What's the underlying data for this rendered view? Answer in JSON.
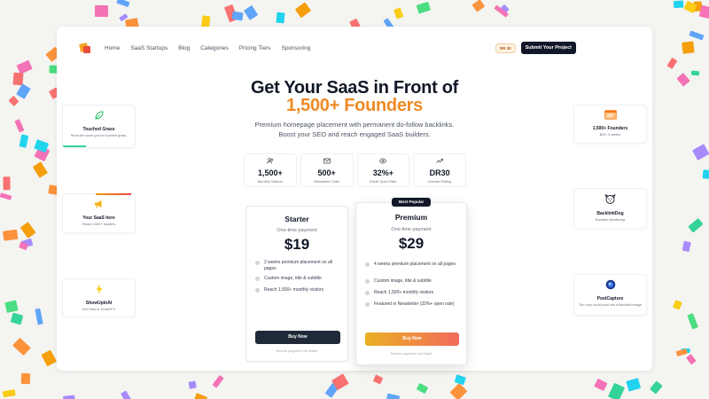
{
  "nav": {
    "links": [
      "Home",
      "SaaS Startups",
      "Blog",
      "Categories",
      "Pricing Tiers",
      "Sponsoring"
    ],
    "dr_badge": "DR 30",
    "submit_label": "Submit Your Project"
  },
  "hero": {
    "title_line1": "Get Your SaaS in Front of",
    "title_line2": "1,500+ Founders",
    "subtitle_line1": "Premium homepage placement with permanent do-follow backlinks.",
    "subtitle_line2": "Boost your SEO and reach engaged SaaS builders.",
    "accent_color": "#f08a24"
  },
  "stats": [
    {
      "icon": "users-icon",
      "value": "1,500+",
      "label": "Monthly Visitors"
    },
    {
      "icon": "mail-icon",
      "value": "500+",
      "label": "Newsletter Subs"
    },
    {
      "icon": "eye-icon",
      "value": "32%+",
      "label": "Email Open Rate"
    },
    {
      "icon": "trend-up-icon",
      "value": "DR30",
      "label": "Domain Rating"
    }
  ],
  "plans": {
    "starter": {
      "name": "Starter",
      "period": "One-time payment",
      "price": "$19",
      "features": [
        "2 weeks premium placement on all pages",
        "Custom image, title & subtitle",
        "Reach 1,500+ monthly visitors"
      ],
      "cta": "Buy Now",
      "note": "Secure payment via Stripe"
    },
    "premium": {
      "badge": "Most Popular",
      "name": "Premium",
      "period": "One-time payment",
      "price": "$29",
      "features": [
        "4 weeks premium placement on all pages",
        "Custom image, title & subtitle",
        "Reach 1,500+ monthly visitors",
        "Featured in Newsletter (32%+ open rate)"
      ],
      "cta": "Buy Now",
      "note": "Secure payment via Stripe"
    }
  },
  "left_promos": [
    {
      "icon": "leaf-icon",
      "name": "Touched Grass",
      "desc": "Show the world you've touched grass."
    },
    {
      "icon": "megaphone-icon",
      "name": "Your SaaS here",
      "desc": "Reach 1500+ builders"
    },
    {
      "icon": "lightning-icon",
      "name": "ShowUpInAI",
      "desc": "Get Cited in ChatGPT!"
    }
  ],
  "right_promos": [
    {
      "icon": "browser-icon",
      "name": "1,500+ Founders",
      "desc": "$29 / 4 weeks"
    },
    {
      "icon": "dog-icon",
      "name": "BacklinkDog",
      "desc": "Backlink Monitoring"
    },
    {
      "icon": "globe-icon",
      "name": "PostCapture",
      "desc": "Turn any social post into a beautiful image"
    }
  ]
}
